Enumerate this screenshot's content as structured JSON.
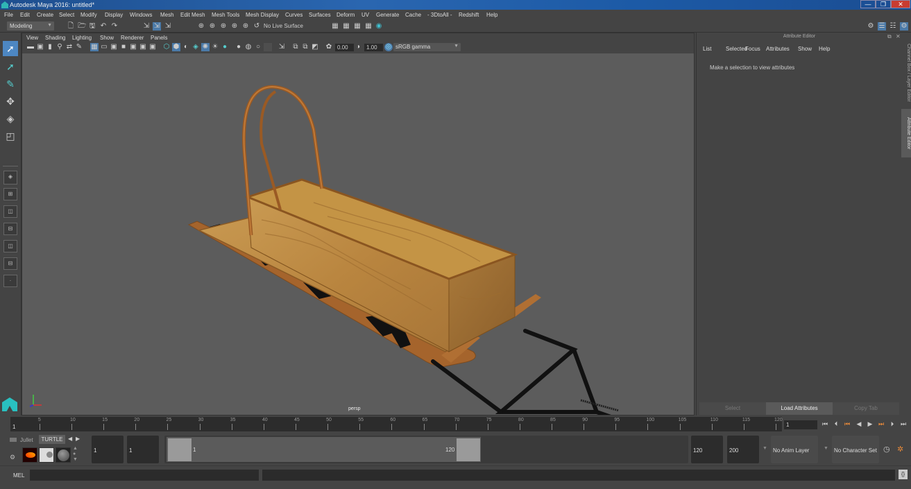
{
  "window": {
    "title": "Autodesk Maya 2016: untitled*",
    "minimize": "—",
    "restore": "❐",
    "close": "✕"
  },
  "menubar": [
    "File",
    "Edit",
    "Create",
    "Select",
    "Modify",
    "Display",
    "Windows",
    "Mesh",
    "Edit Mesh",
    "Mesh Tools",
    "Mesh Display",
    "Curves",
    "Surfaces",
    "Deform",
    "UV",
    "Generate",
    "Cache",
    "- 3DtoAll -",
    "Redshift",
    "Help"
  ],
  "shelf": {
    "mode": "Modeling",
    "live_surface": "No Live Surface"
  },
  "viewport": {
    "menu": [
      "View",
      "Shading",
      "Lighting",
      "Show",
      "Renderer",
      "Panels"
    ],
    "exposure": "0.00",
    "gamma": "1.00",
    "color_space": "sRGB gamma",
    "camera": "persp"
  },
  "attribute_editor": {
    "title": "Attribute Editor",
    "menu": [
      "List",
      "Selected",
      "Focus",
      "Attributes",
      "Show",
      "Help"
    ],
    "message": "Make a selection to view attributes",
    "buttons": {
      "select": "Select",
      "load": "Load Attributes",
      "copy": "Copy Tab"
    }
  },
  "side_tabs": {
    "channel_box": "Channel Box / Layer Editor",
    "attribute_editor": "Attribute Editor"
  },
  "timeline": {
    "start_label": "1",
    "ticks": [
      "5",
      "10",
      "15",
      "20",
      "25",
      "30",
      "35",
      "40",
      "45",
      "50",
      "55",
      "60",
      "65",
      "70",
      "75",
      "80",
      "85",
      "90",
      "95",
      "100",
      "105",
      "110",
      "115",
      "120"
    ],
    "current_frame": "1"
  },
  "range": {
    "shelf_tabs": [
      "Jullet",
      "TURTLE"
    ],
    "start_frame": "1",
    "playback_start": "1",
    "range_start_label": "1",
    "range_end_label": "120",
    "playback_end": "120",
    "end_frame": "200",
    "anim_layer": "No Anim Layer",
    "character_set": "No Character Set"
  },
  "command_line": {
    "label": "MEL",
    "value": "",
    "result": ""
  }
}
